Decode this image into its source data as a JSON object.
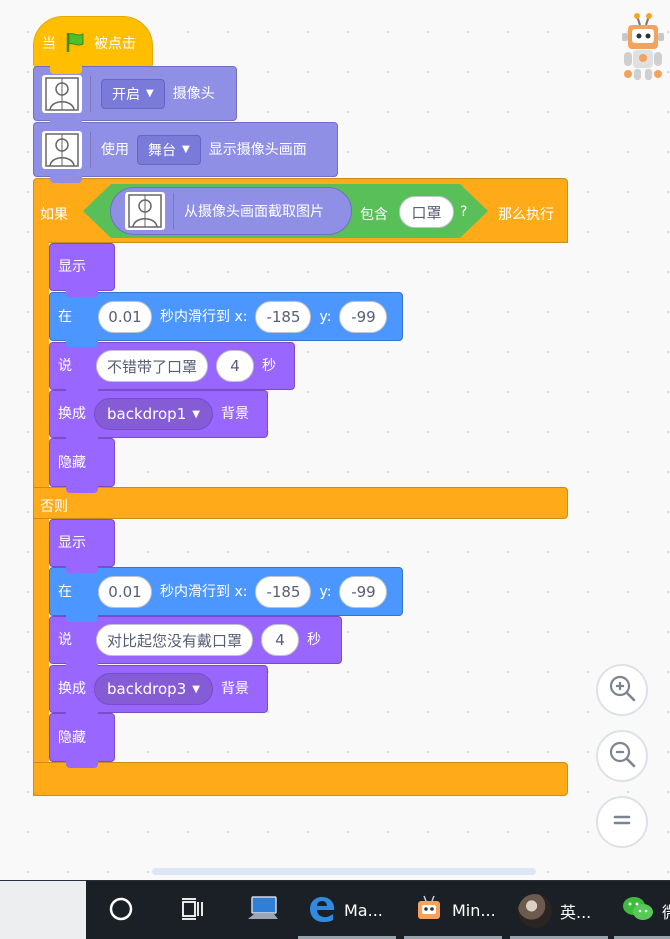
{
  "script": {
    "when_flag": {
      "prefix": "当",
      "suffix": "被点击"
    },
    "camera_toggle": {
      "option": "开启",
      "suffix": "摄像头"
    },
    "camera_show": {
      "prefix": "使用",
      "option": "舞台",
      "suffix": "显示摄像头画面"
    },
    "if_block": {
      "if_label": "如果",
      "then_label": "那么执行",
      "else_label": "否则",
      "condition": {
        "reporter": "从摄像头画面截取图片",
        "contains": "包含",
        "object": "口罩",
        "question": "?"
      }
    },
    "then_branch": {
      "show": "显示",
      "glide": {
        "prefix": "在",
        "secs": "0.01",
        "mid": "秒内滑行到 x:",
        "x": "-185",
        "ylabel": "y:",
        "y": "-99"
      },
      "say": {
        "prefix": "说",
        "message": "不错带了口罩",
        "secs": "4",
        "suffix": "秒"
      },
      "switch": {
        "prefix": "换成",
        "backdrop": "backdrop1",
        "suffix": "背景"
      },
      "hide": "隐藏"
    },
    "else_branch": {
      "show": "显示",
      "glide": {
        "prefix": "在",
        "secs": "0.01",
        "mid": "秒内滑行到 x:",
        "x": "-185",
        "ylabel": "y:",
        "y": "-99"
      },
      "say": {
        "prefix": "说",
        "message": "对比起您没有戴口罩",
        "secs": "4",
        "suffix": "秒"
      },
      "switch": {
        "prefix": "换成",
        "backdrop": "backdrop3",
        "suffix": "背景"
      },
      "hide": "隐藏"
    }
  },
  "zoom_controls": {
    "zoom_in_icon": "zoom-in-icon",
    "zoom_out_icon": "zoom-out-icon",
    "reset_icon": "equals-icon"
  },
  "taskbar": {
    "items": [
      {
        "icon": "cortana-circle-icon",
        "label": ""
      },
      {
        "icon": "task-view-icon",
        "label": ""
      },
      {
        "icon": "computer-icon",
        "label": ""
      },
      {
        "icon": "edge-icon",
        "label": "Ma..."
      },
      {
        "icon": "mind-app-icon",
        "label": "Min..."
      },
      {
        "icon": "avatar-photo",
        "label": "英..."
      },
      {
        "icon": "wechat-icon",
        "label": "微"
      }
    ]
  },
  "colors": {
    "events": "#ffbf00",
    "control": "#ffab19",
    "looks": "#9966ff",
    "motion": "#4c97ff",
    "extension": "#8f90e5",
    "operator": "#59c059"
  }
}
